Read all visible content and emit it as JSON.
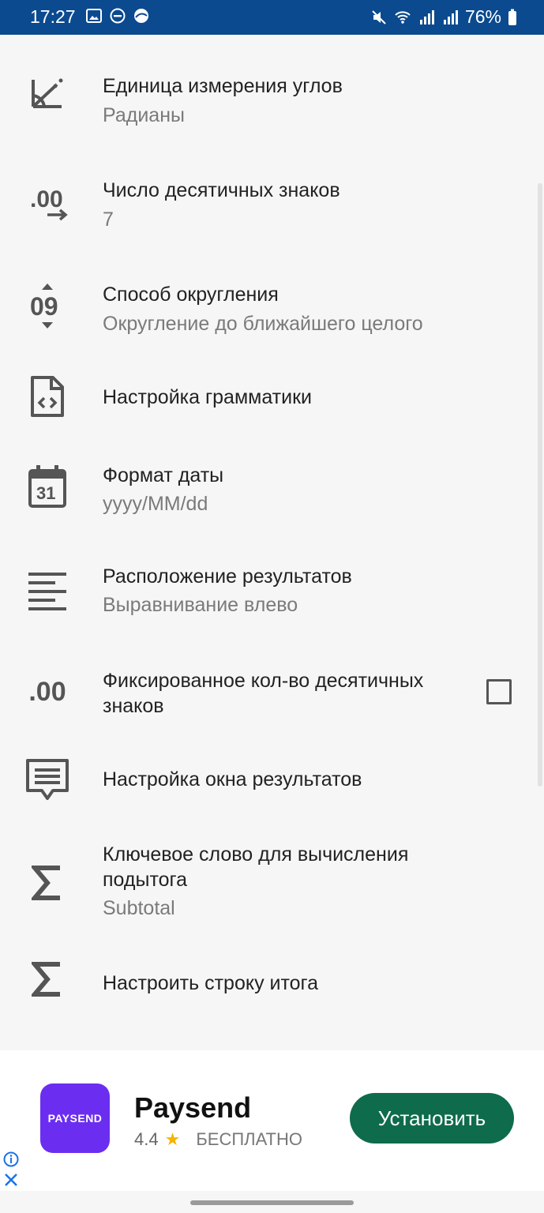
{
  "status_bar": {
    "time": "17:27",
    "battery": "76%",
    "left_icons": [
      "image-icon",
      "dnd-icon",
      "browser-icon"
    ],
    "right_icons": [
      "mute-icon",
      "wifi-icon",
      "signal-icon",
      "signal-icon",
      "battery-icon"
    ]
  },
  "settings": [
    {
      "title": "Единица измерения углов",
      "subtitle": "Радианы",
      "icon": "angle-icon"
    },
    {
      "title": "Число десятичных знаков",
      "subtitle": "7",
      "icon": "decimal-places-icon"
    },
    {
      "title": "Способ округления",
      "subtitle": "Округление до ближайшего целого",
      "icon": "rounding-icon"
    },
    {
      "title": "Настройка грамматики",
      "icon": "code-file-icon"
    },
    {
      "title": "Формат даты",
      "subtitle": "yyyy/MM/dd",
      "icon": "calendar-icon"
    },
    {
      "title": "Расположение результатов",
      "subtitle": "Выравнивание влево",
      "icon": "align-left-icon"
    },
    {
      "title": "Фиксированное кол-во десятичных знаков",
      "icon": "fixed-decimal-icon",
      "checked": false
    },
    {
      "title": "Настройка окна результатов",
      "icon": "comment-icon"
    },
    {
      "title": "Ключевое слово для вычисления подытога",
      "subtitle": "Subtotal",
      "icon": "sigma-icon"
    },
    {
      "title": "Настроить строку итога",
      "icon": "sigma-icon"
    }
  ],
  "icon_text": {
    "decimal": ".00",
    "rounding": "09",
    "calendar_day": "31",
    "fixed_decimal": ".00"
  },
  "ad": {
    "app_logo_text": "PAYSEND",
    "app_name": "Paysend",
    "rating": "4.4",
    "price": "БЕСПЛАТНО",
    "install_label": "Установить",
    "colors": {
      "logo_bg": "#6b2ef0",
      "install_bg": "#0e6b4c",
      "star": "#f4b400"
    }
  }
}
